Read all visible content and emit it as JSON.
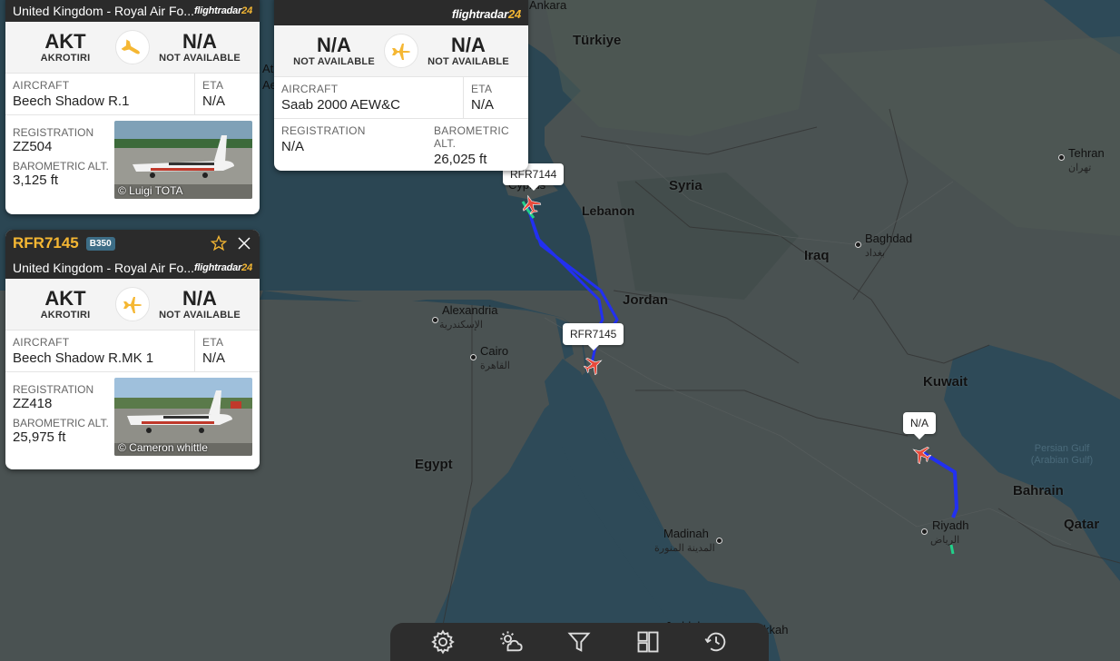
{
  "cards": [
    {
      "callsign": "",
      "operator": "United Kingdom - Royal Air Fo...",
      "from_code": "AKT",
      "from_name": "AKROTIRI",
      "to_code": "N/A",
      "to_name": "NOT AVAILABLE",
      "aircraft_label": "AIRCRAFT",
      "aircraft": "Beech Shadow R.1",
      "eta_label": "ETA",
      "eta": "N/A",
      "registration_label": "REGISTRATION",
      "registration": "ZZ504",
      "alt_label": "BAROMETRIC ALT.",
      "alt": "3,125 ft",
      "photo_credit": "© Luigi TOTA"
    },
    {
      "callsign": "RFR7145",
      "type_badge": "B350",
      "operator": "United Kingdom - Royal Air Fo...",
      "from_code": "AKT",
      "from_name": "AKROTIRI",
      "to_code": "N/A",
      "to_name": "NOT AVAILABLE",
      "aircraft_label": "AIRCRAFT",
      "aircraft": "Beech Shadow R.MK 1",
      "eta_label": "ETA",
      "eta": "N/A",
      "registration_label": "REGISTRATION",
      "registration": "ZZ418",
      "alt_label": "BAROMETRIC ALT.",
      "alt": "25,975 ft",
      "photo_credit": "© Cameron whittle"
    },
    {
      "from_code": "N/A",
      "from_name": "NOT AVAILABLE",
      "to_code": "N/A",
      "to_name": "NOT AVAILABLE",
      "aircraft_label": "AIRCRAFT",
      "aircraft": "Saab 2000 AEW&C",
      "eta_label": "ETA",
      "eta": "N/A",
      "registration_label": "REGISTRATION",
      "registration": "N/A",
      "alt_label": "BAROMETRIC ALT.",
      "alt": "26,025 ft"
    }
  ],
  "brand": {
    "main": "flightradar",
    "suffix": "24"
  },
  "map": {
    "countries": [
      "Türkiye",
      "Syria",
      "Lebanon",
      "Iraq",
      "Jordan",
      "Kuwait",
      "Egypt",
      "Bahrain",
      "Qatar"
    ],
    "cities": [
      "Ankara",
      "Baghdad",
      "Tehran",
      "Alexandria",
      "Cairo",
      "Madinah",
      "Riyadh"
    ],
    "arabic": [
      "بغداد",
      "تهران",
      "الإسكندرية",
      "القاهرة",
      "المدينة المنورة",
      "الرياض"
    ],
    "water": "Persian Gulf (Arabian Gulf)",
    "partial_labels": [
      "Jeddah",
      "Makkah"
    ],
    "fragments": [
      "At",
      "Ae",
      "Cyprus"
    ],
    "callouts": [
      "RFR7144",
      "RFR7145",
      "N/A"
    ]
  },
  "colors": {
    "track": "#2230f0",
    "accent": "#f5b733",
    "plane": "#e84a3c"
  },
  "toolbar": [
    "settings-icon",
    "weather-icon",
    "filter-icon",
    "widgets-icon",
    "playback-icon"
  ]
}
